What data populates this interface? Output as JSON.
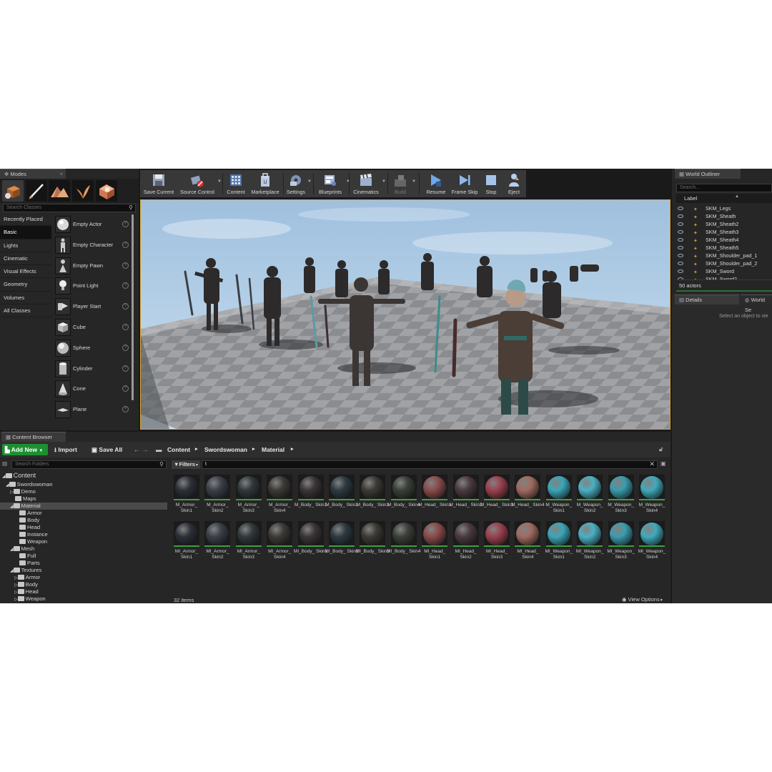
{
  "modes": {
    "tab_title": "Modes",
    "search_placeholder": "Search Classes",
    "categories": [
      "Recently Placed",
      "Basic",
      "Lights",
      "Cinematic",
      "Visual Effects",
      "Geometry",
      "Volumes",
      "All Classes"
    ],
    "active_category": "Basic",
    "items": [
      "Empty Actor",
      "Empty Character",
      "Empty Pawn",
      "Point Light",
      "Player Start",
      "Cube",
      "Sphere",
      "Cylinder",
      "Cone",
      "Plane"
    ]
  },
  "toolbar": {
    "buttons": [
      "Save Current",
      "Source Control",
      "Content",
      "Marketplace",
      "Settings",
      "Blueprints",
      "Cinematics",
      "Build",
      "Resume",
      "Frame Skip",
      "Stop",
      "Eject"
    ]
  },
  "outliner": {
    "tab_title": "World Outliner",
    "search_placeholder": "Search...",
    "column_label": "Label",
    "rows": [
      "SKM_Legs",
      "SKM_Sheath",
      "SKM_Sheath2",
      "SKM_Sheath3",
      "SKM_Sheath4",
      "SKM_Sheath5",
      "SKM_Shoulder_pad_1",
      "SKM_Shoulder_pad_2",
      "SKM_Sword",
      "SKM_Sword2"
    ],
    "actor_count": "50 actors"
  },
  "details": {
    "tab_title": "Details",
    "tab2_title": "World Se",
    "hint": "Select an object to vie"
  },
  "content_browser": {
    "tab_title": "Content Browser",
    "add_new": "Add New",
    "import": "Import",
    "save_all": "Save All",
    "breadcrumb": [
      "Content",
      "Swordswoman",
      "Material"
    ],
    "folder_search_placeholder": "Search Folders",
    "filters_label": "Filters",
    "search_value": "t",
    "tree": [
      {
        "label": "Content",
        "depth": 0
      },
      {
        "label": "Swordswoman",
        "depth": 1
      },
      {
        "label": "Demo",
        "depth": 2
      },
      {
        "label": "Maps",
        "depth": 2
      },
      {
        "label": "Material",
        "depth": 2
      },
      {
        "label": "Armor",
        "depth": 3
      },
      {
        "label": "Body",
        "depth": 3
      },
      {
        "label": "Head",
        "depth": 3
      },
      {
        "label": "Instance",
        "depth": 3
      },
      {
        "label": "Weapon",
        "depth": 3
      },
      {
        "label": "Mesh",
        "depth": 2
      },
      {
        "label": "Full",
        "depth": 3
      },
      {
        "label": "Parts",
        "depth": 3
      },
      {
        "label": "Textures",
        "depth": 2
      },
      {
        "label": "Armor",
        "depth": 3
      },
      {
        "label": "Body",
        "depth": 3
      },
      {
        "label": "Head",
        "depth": 3
      },
      {
        "label": "Weapon",
        "depth": 3
      }
    ],
    "assets_row1": [
      "M_Armor_ Skin1",
      "M_Armor_ Skin2",
      "M_Armor_ Skin3",
      "M_Armor_ Skin4",
      "M_Body_ Skin1",
      "M_Body_ Skin2",
      "M_Body_ Skin3",
      "M_Body_ Skin4",
      "M_Head_ Skin1",
      "M_Head_ Skin2",
      "M_Head_ Skin3",
      "M_Head_ Skin4",
      "M_Weapon_ Skin1",
      "M_Weapon_ Skin2",
      "M_Weapon_ Skin3",
      "M_Weapon_ Skin4"
    ],
    "assets_row2": [
      "MI_Armor_ Skin1",
      "MI_Armor_ Skin2",
      "MI_Armor_ Skin3",
      "MI_Armor_ Skin4",
      "MI_Body_ Skin1",
      "MI_Body_ Skin2",
      "MI_Body_ Skin3",
      "MI_Body_ Skin4",
      "MI_Head_ Skin1",
      "MI_Head_ Skin2",
      "MI_Head_ Skin3",
      "MI_Head_ Skin4",
      "MI_Weapon_ Skin1",
      "MI_Weapon_ Skin2",
      "MI_Weapon_ Skin3",
      "MI_Weapon_ Skin4"
    ],
    "item_count": "32 items",
    "view_options": "View Options"
  },
  "colors": {
    "accent_green": "#1e8f32",
    "viewport_border": "#d8a430",
    "panel_bg": "#262626"
  }
}
